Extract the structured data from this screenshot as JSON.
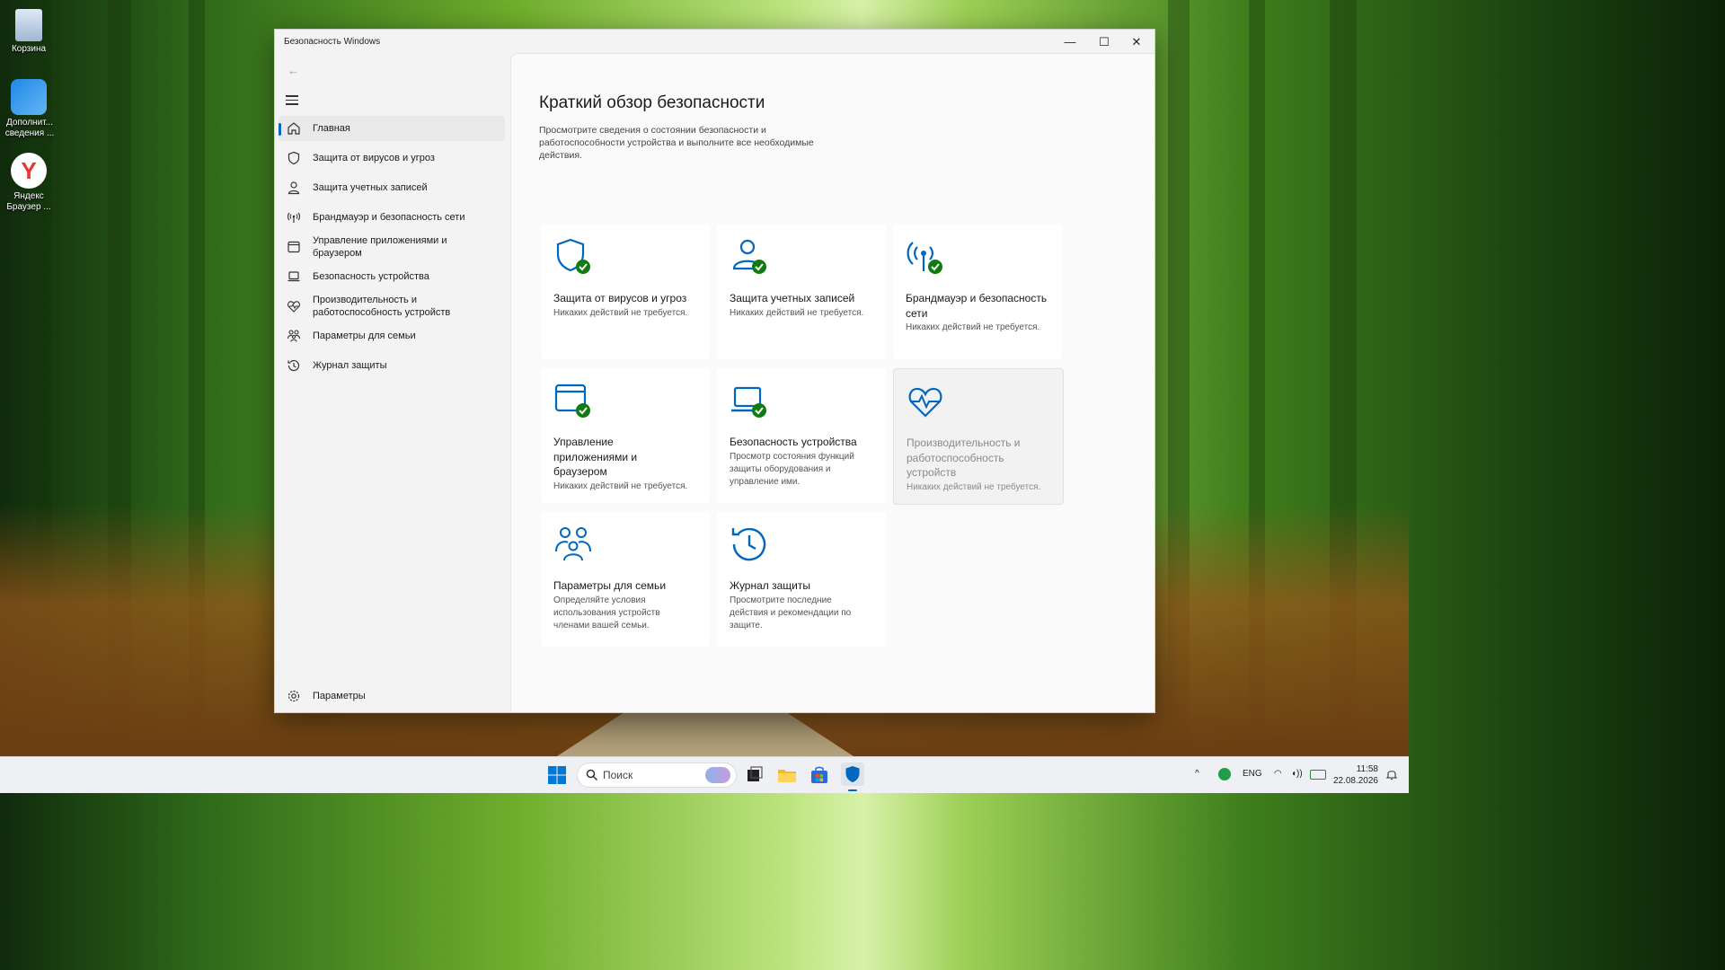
{
  "desktop": {
    "icons": [
      {
        "label": "Корзина"
      },
      {
        "label": "Дополнит... сведения ..."
      },
      {
        "label": "Яндекс Браузер ..."
      }
    ]
  },
  "window": {
    "title": "Безопасность Windows",
    "controls": {
      "minimize": "—",
      "maximize": "☐",
      "close": "✕"
    }
  },
  "nav": {
    "back": "←",
    "items": [
      {
        "label": "Главная",
        "icon": "home-icon",
        "active": true
      },
      {
        "label": "Защита от вирусов и угроз",
        "icon": "shield-icon"
      },
      {
        "label": "Защита учетных записей",
        "icon": "person-icon"
      },
      {
        "label": "Брандмауэр и безопасность сети",
        "icon": "wifi-antenna-icon"
      },
      {
        "label": "Управление приложениями и браузером",
        "icon": "browser-window-icon"
      },
      {
        "label": "Безопасность устройства",
        "icon": "laptop-icon"
      },
      {
        "label": "Производительность и работоспособность устройств",
        "icon": "heart-pulse-icon"
      },
      {
        "label": "Параметры для семьи",
        "icon": "family-icon"
      },
      {
        "label": "Журнал защиты",
        "icon": "history-icon"
      }
    ],
    "settings": "Параметры"
  },
  "main": {
    "title": "Краткий обзор безопасности",
    "description": "Просмотрите сведения о состоянии безопасности и работоспособности устройства и выполните все необходимые действия.",
    "cards": [
      {
        "title": "Защита от вирусов и угроз",
        "status": "Никаких действий не требуется.",
        "icon": "shield-check-icon"
      },
      {
        "title": "Защита учетных записей",
        "status": "Никаких действий не требуется.",
        "icon": "person-check-icon"
      },
      {
        "title": "Брандмауэр и безопасность сети",
        "status": "Никаких действий не требуется.",
        "icon": "antenna-check-icon"
      },
      {
        "title": "Управление приложениями и браузером",
        "status": "Никаких действий не требуется.",
        "icon": "browser-check-icon"
      },
      {
        "title": "Безопасность устройства",
        "status": "Просмотр состояния функций защиты оборудования и управление ими.",
        "icon": "laptop-check-icon"
      },
      {
        "title": "Производительность и работоспособность устройств",
        "status": "Никаких действий не требуется.",
        "icon": "heart-pulse-icon"
      },
      {
        "title": "Параметры для семьи",
        "status": "Определяйте условия использования устройств членами вашей семьи.",
        "icon": "family-icon"
      },
      {
        "title": "Журнал защиты",
        "status": "Просмотрите последние действия и рекомендации по защите.",
        "icon": "history-icon"
      }
    ]
  },
  "taskbar": {
    "search_placeholder": "Поиск",
    "tray": {
      "lang": "ENG",
      "time": "11:58",
      "date": "22.08.2026"
    }
  },
  "colors": {
    "accent": "#0067c0",
    "ok": "#107c10"
  }
}
